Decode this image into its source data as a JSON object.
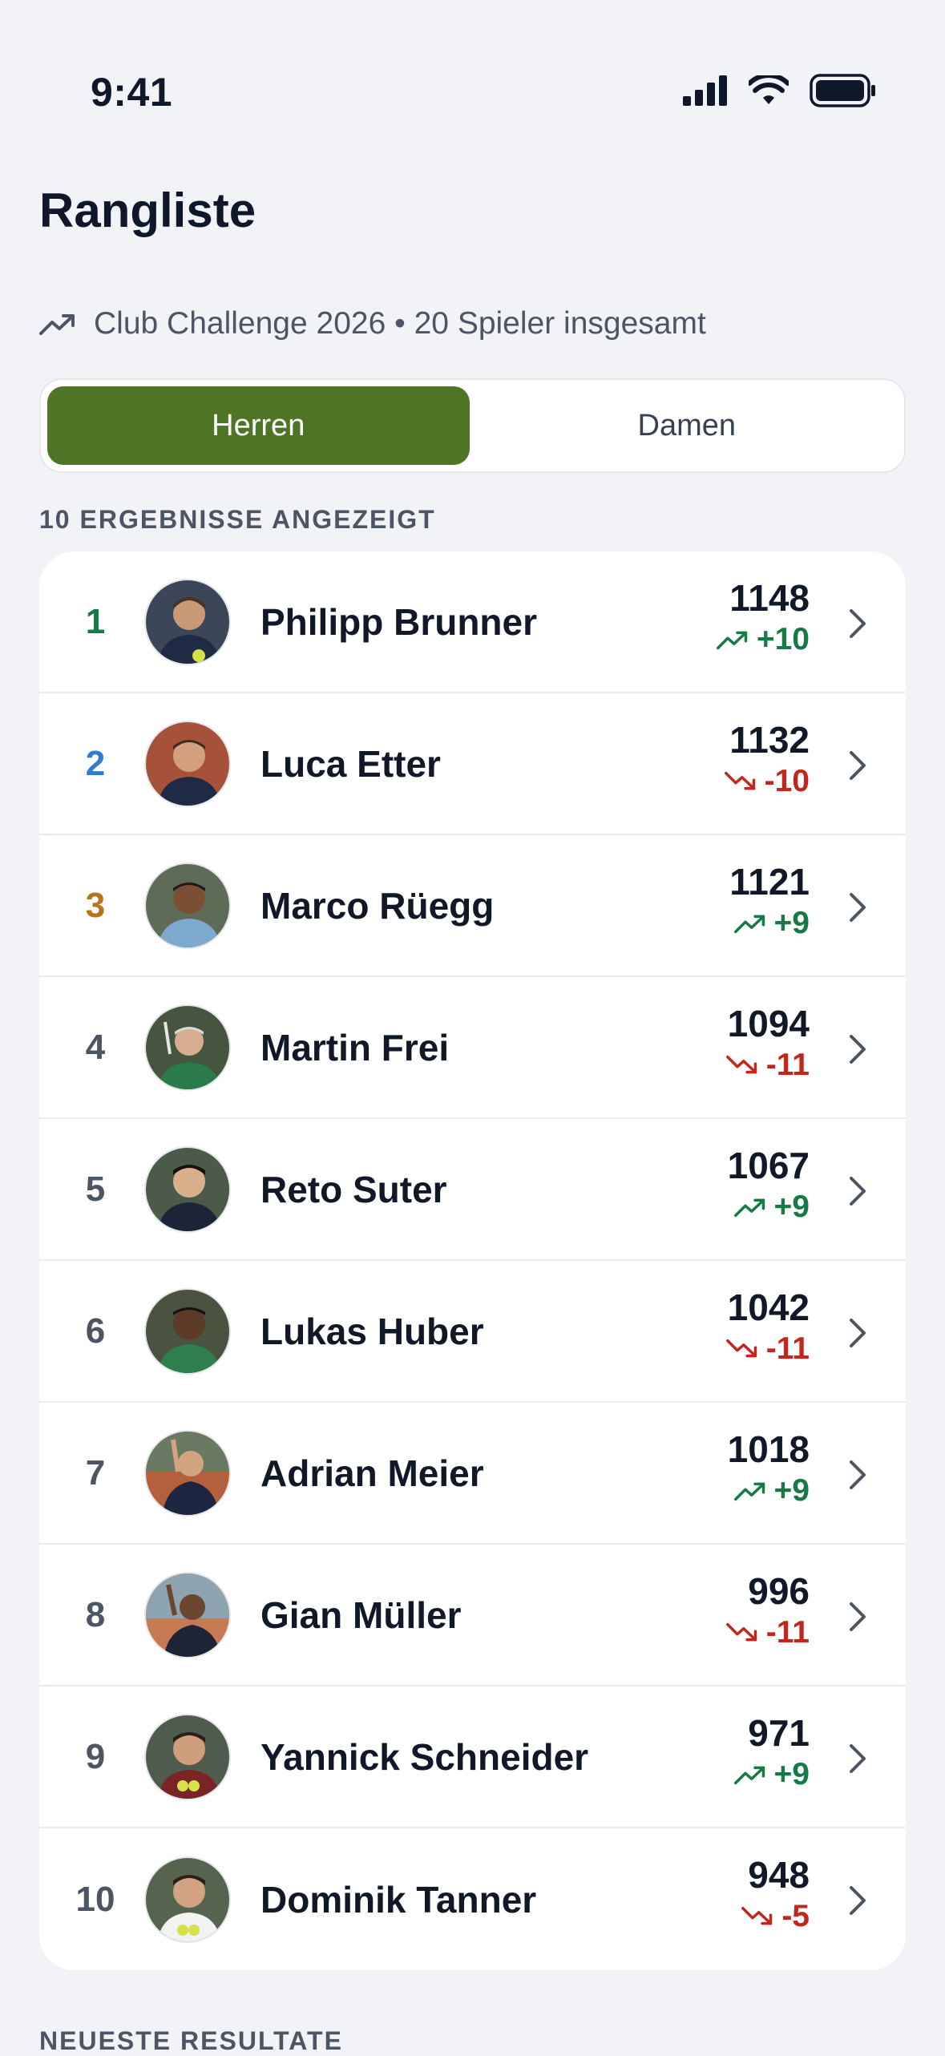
{
  "status_bar": {
    "time": "9:41"
  },
  "header": {
    "title": "Rangliste",
    "subtitle": "Club Challenge 2026 • 20 Spieler insgesamt"
  },
  "tabs": [
    {
      "label": "Herren",
      "active": true
    },
    {
      "label": "Damen",
      "active": false
    }
  ],
  "results_count_label": "10 ERGEBNISSE ANGEZEIGT",
  "players": [
    {
      "rank": "1",
      "name": "Philipp Brunner",
      "points": "1148",
      "delta": "+10",
      "trend": "up"
    },
    {
      "rank": "2",
      "name": "Luca Etter",
      "points": "1132",
      "delta": "-10",
      "trend": "down"
    },
    {
      "rank": "3",
      "name": "Marco Rüegg",
      "points": "1121",
      "delta": "+9",
      "trend": "up"
    },
    {
      "rank": "4",
      "name": "Martin Frei",
      "points": "1094",
      "delta": "-11",
      "trend": "down"
    },
    {
      "rank": "5",
      "name": "Reto Suter",
      "points": "1067",
      "delta": "+9",
      "trend": "up"
    },
    {
      "rank": "6",
      "name": "Lukas Huber",
      "points": "1042",
      "delta": "-11",
      "trend": "down"
    },
    {
      "rank": "7",
      "name": "Adrian Meier",
      "points": "1018",
      "delta": "+9",
      "trend": "up"
    },
    {
      "rank": "8",
      "name": "Gian Müller",
      "points": "996",
      "delta": "-11",
      "trend": "down"
    },
    {
      "rank": "9",
      "name": "Yannick Schneider",
      "points": "971",
      "delta": "+9",
      "trend": "up"
    },
    {
      "rank": "10",
      "name": "Dominik Tanner",
      "points": "948",
      "delta": "-5",
      "trend": "down"
    }
  ],
  "next_section_label": "NEUESTE RESULTATE",
  "colors": {
    "accent": "#4e7526",
    "up": "#157a44",
    "down": "#c2261c",
    "rank1": "#157a44",
    "rank2": "#2f7bd0",
    "rank3": "#b7741a"
  }
}
